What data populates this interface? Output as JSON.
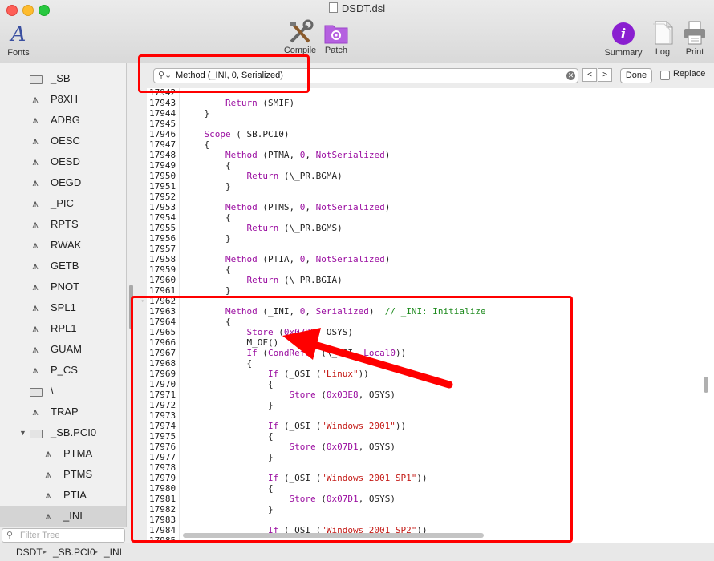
{
  "window": {
    "title": "DSDT.dsl"
  },
  "toolbar": {
    "fonts": "Fonts",
    "compile": "Compile",
    "patch": "Patch",
    "summary": "Summary",
    "log": "Log",
    "print": "Print"
  },
  "search": {
    "value": "Method (_INI, 0, Serialized)",
    "prev": "<",
    "next": ">",
    "done": "Done",
    "replace": "Replace"
  },
  "sidebar": {
    "items": [
      {
        "label": "_SB",
        "icon": "folder-icon"
      },
      {
        "label": "P8XH",
        "icon": "method-icon"
      },
      {
        "label": "ADBG",
        "icon": "method-icon"
      },
      {
        "label": "OESC",
        "icon": "method-icon"
      },
      {
        "label": "OESD",
        "icon": "method-icon"
      },
      {
        "label": "OEGD",
        "icon": "method-icon"
      },
      {
        "label": "_PIC",
        "icon": "method-icon"
      },
      {
        "label": "RPTS",
        "icon": "method-icon"
      },
      {
        "label": "RWAK",
        "icon": "method-icon"
      },
      {
        "label": "GETB",
        "icon": "method-icon"
      },
      {
        "label": "PNOT",
        "icon": "method-icon"
      },
      {
        "label": "SPL1",
        "icon": "method-icon"
      },
      {
        "label": "RPL1",
        "icon": "method-icon"
      },
      {
        "label": "GUAM",
        "icon": "method-icon"
      },
      {
        "label": "P_CS",
        "icon": "method-icon"
      },
      {
        "label": "\\",
        "icon": "folder-icon"
      },
      {
        "label": "TRAP",
        "icon": "method-icon"
      },
      {
        "label": "_SB.PCI0",
        "icon": "folder-icon"
      },
      {
        "label": "PTMA",
        "icon": "method-icon"
      },
      {
        "label": "PTMS",
        "icon": "method-icon"
      },
      {
        "label": "PTIA",
        "icon": "method-icon"
      },
      {
        "label": "_INI",
        "icon": "method-icon"
      }
    ],
    "filter_placeholder": "Filter Tree"
  },
  "editor": {
    "lines": [
      {
        "n": "17942",
        "t": ""
      },
      {
        "n": "17943",
        "t": "        Return (SMIF)"
      },
      {
        "n": "17944",
        "t": "    }"
      },
      {
        "n": "17945",
        "t": ""
      },
      {
        "n": "17946",
        "t": "    Scope (_SB.PCI0)"
      },
      {
        "n": "17947",
        "t": "    {"
      },
      {
        "n": "17948",
        "t": "        Method (PTMA, 0, NotSerialized)"
      },
      {
        "n": "17949",
        "t": "        {"
      },
      {
        "n": "17950",
        "t": "            Return (\\_PR.BGMA)"
      },
      {
        "n": "17951",
        "t": "        }"
      },
      {
        "n": "17952",
        "t": ""
      },
      {
        "n": "17953",
        "t": "        Method (PTMS, 0, NotSerialized)"
      },
      {
        "n": "17954",
        "t": "        {"
      },
      {
        "n": "17955",
        "t": "            Return (\\_PR.BGMS)"
      },
      {
        "n": "17956",
        "t": "        }"
      },
      {
        "n": "17957",
        "t": ""
      },
      {
        "n": "17958",
        "t": "        Method (PTIA, 0, NotSerialized)"
      },
      {
        "n": "17959",
        "t": "        {"
      },
      {
        "n": "17960",
        "t": "            Return (\\_PR.BGIA)"
      },
      {
        "n": "17961",
        "t": "        }"
      },
      {
        "n": "17962",
        "t": ""
      },
      {
        "n": "17963",
        "t": "        Method (_INI, 0, Serialized)  // _INI: Initialize"
      },
      {
        "n": "17964",
        "t": "        {"
      },
      {
        "n": "17965",
        "t": "            Store (0x07D9, OSYS)"
      },
      {
        "n": "17966",
        "t": "            M_OF()"
      },
      {
        "n": "17967",
        "t": "            If (CondRefOf (\\_OSI, Local0))"
      },
      {
        "n": "17968",
        "t": "            {"
      },
      {
        "n": "17969",
        "t": "                If (_OSI (\"Linux\"))"
      },
      {
        "n": "17970",
        "t": "                {"
      },
      {
        "n": "17971",
        "t": "                    Store (0x03E8, OSYS)"
      },
      {
        "n": "17972",
        "t": "                }"
      },
      {
        "n": "17973",
        "t": ""
      },
      {
        "n": "17974",
        "t": "                If (_OSI (\"Windows 2001\"))"
      },
      {
        "n": "17975",
        "t": "                {"
      },
      {
        "n": "17976",
        "t": "                    Store (0x07D1, OSYS)"
      },
      {
        "n": "17977",
        "t": "                }"
      },
      {
        "n": "17978",
        "t": ""
      },
      {
        "n": "17979",
        "t": "                If (_OSI (\"Windows 2001 SP1\"))"
      },
      {
        "n": "17980",
        "t": "                {"
      },
      {
        "n": "17981",
        "t": "                    Store (0x07D1, OSYS)"
      },
      {
        "n": "17982",
        "t": "                }"
      },
      {
        "n": "17983",
        "t": ""
      },
      {
        "n": "17984",
        "t": "                If (_OSI (\"Windows 2001 SP2\"))"
      },
      {
        "n": "17985",
        "t": ""
      }
    ]
  },
  "statusbar": {
    "crumbs": [
      "DSDT",
      "_SB.PCI0",
      "_INI"
    ],
    "separator": "▸"
  },
  "colors": {
    "keyword": "#9b0fa1",
    "string": "#c41a16",
    "comment": "#1f8b1f",
    "annotation": "#ff0000"
  }
}
